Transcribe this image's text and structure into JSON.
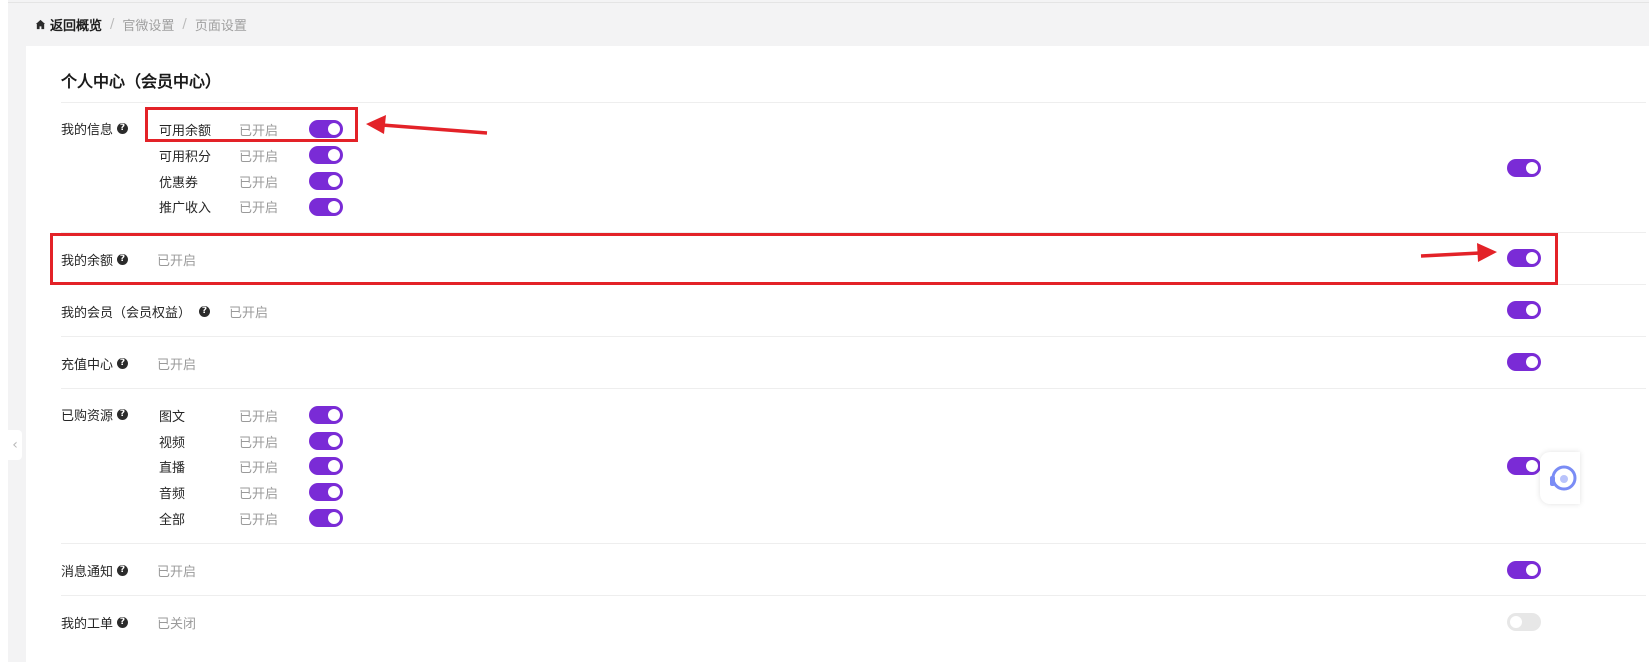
{
  "breadcrumb": {
    "home_label": "返回概览",
    "separator": "/",
    "items": [
      "官微设置",
      "页面设置"
    ]
  },
  "section": {
    "title": "个人中心（会员中心）"
  },
  "rows": {
    "my_info": {
      "label": "我的信息",
      "enabled": true,
      "sub_items": [
        {
          "label": "可用余额",
          "status": "已开启",
          "enabled": true
        },
        {
          "label": "可用积分",
          "status": "已开启",
          "enabled": true
        },
        {
          "label": "优惠券",
          "status": "已开启",
          "enabled": true
        },
        {
          "label": "推广收入",
          "status": "已开启",
          "enabled": true
        }
      ]
    },
    "my_balance": {
      "label": "我的余额",
      "status": "已开启",
      "enabled": true
    },
    "my_membership": {
      "label": "我的会员（会员权益）",
      "status": "已开启",
      "enabled": true
    },
    "recharge_center": {
      "label": "充值中心",
      "status": "已开启",
      "enabled": true
    },
    "purchased_resources": {
      "label": "已购资源",
      "enabled": true,
      "sub_items": [
        {
          "label": "图文",
          "status": "已开启",
          "enabled": true
        },
        {
          "label": "视频",
          "status": "已开启",
          "enabled": true
        },
        {
          "label": "直播",
          "status": "已开启",
          "enabled": true
        },
        {
          "label": "音频",
          "status": "已开启",
          "enabled": true
        },
        {
          "label": "全部",
          "status": "已开启",
          "enabled": true
        }
      ]
    },
    "notifications": {
      "label": "消息通知",
      "status": "已开启",
      "enabled": true
    },
    "my_tickets": {
      "label": "我的工单",
      "status": "已关闭",
      "enabled": false
    }
  },
  "icons": {
    "home": "home-icon",
    "help": "question-circle-icon",
    "collapse": "chevron-left-icon",
    "service": "headset-icon"
  },
  "colors": {
    "toggle_on": "#7a2bd6",
    "toggle_off": "#e7e7e7",
    "highlight": "#e32228"
  }
}
